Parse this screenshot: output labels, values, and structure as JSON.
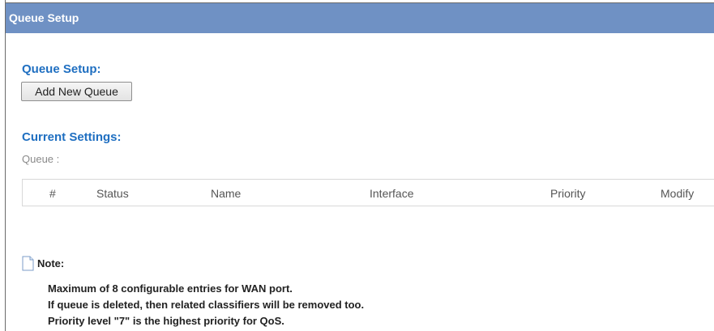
{
  "header": {
    "title": "Queue Setup"
  },
  "queue_setup": {
    "section_title": "Queue Setup:",
    "add_button_label": "Add New Queue"
  },
  "current_settings": {
    "section_title": "Current Settings:",
    "queue_label": "Queue :",
    "table": {
      "columns": [
        "#",
        "Status",
        "Name",
        "Interface",
        "Priority",
        "Modify"
      ],
      "rows": []
    }
  },
  "note": {
    "title": "Note:",
    "lines": [
      "Maximum of 8 configurable entries for WAN port.",
      "If queue is deleted, then related classifiers will be removed too.",
      "Priority level \"7\" is the highest priority for QoS."
    ]
  }
}
